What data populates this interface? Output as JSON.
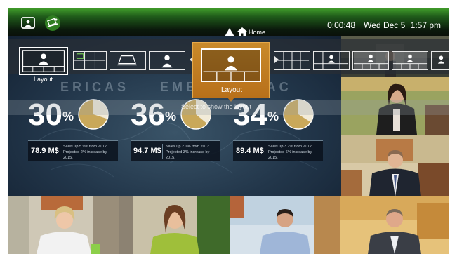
{
  "topbar": {
    "timer": "0:00:48",
    "date": "Wed Dec 5",
    "time": "1:57 pm",
    "icons": [
      "screen-icon",
      "share-icon"
    ]
  },
  "home_nav": {
    "label": "Home"
  },
  "layout_strip": {
    "selected_label": "Layout",
    "popup_label": "Layout",
    "hint": "Select to show the layout"
  },
  "presentation": {
    "regions": [
      "ERICAS",
      "EMEA",
      "PAC"
    ],
    "stats": [
      {
        "percent": "30",
        "money": "78.9 M$",
        "note_line1": "Sales up 5.9% from 2012.",
        "note_line2": "Projected 2% increase by 2015.",
        "share": 0.3
      },
      {
        "percent": "36",
        "money": "94.7 M$",
        "note_line1": "Sales up 2.1% from 2012.",
        "note_line2": "Projected 3% increase by 2015.",
        "share": 0.36
      },
      {
        "percent": "34",
        "money": "89.4 M$",
        "note_line1": "Sales up 3.2% from 2012.",
        "note_line2": "Projected 6% increase by 2015.",
        "share": 0.34
      }
    ],
    "percent_sign": "%"
  },
  "colors": {
    "topbar_green": "#3f9a2a",
    "popup_orange": "#c98a2a",
    "pie_gold": "#c9a85a",
    "pie_light": "#f2ebd8"
  }
}
